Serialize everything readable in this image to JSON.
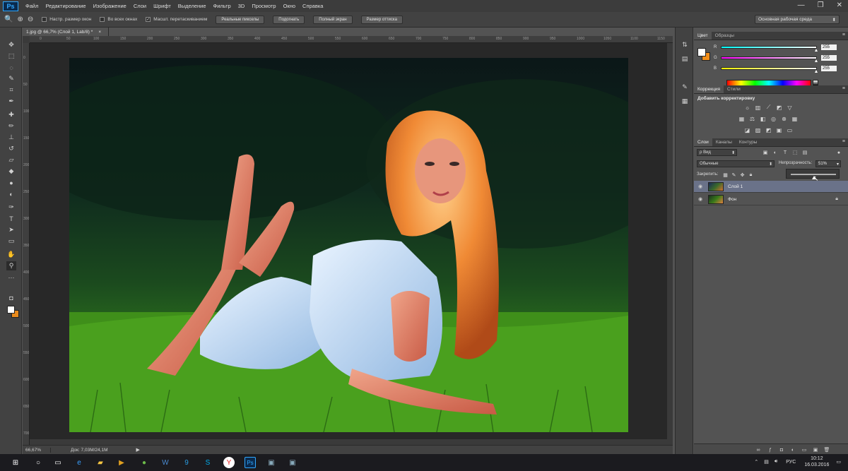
{
  "app": {
    "logo": "Ps"
  },
  "menu": [
    "Файл",
    "Редактирование",
    "Изображение",
    "Слои",
    "Шрифт",
    "Выделение",
    "Фильтр",
    "3D",
    "Просмотр",
    "Окно",
    "Справка"
  ],
  "window_controls": {
    "minimize": "—",
    "restore": "❐",
    "close": "✕"
  },
  "options": {
    "zoom_icon": "🔍",
    "resize_windows": "Настр. размер окон",
    "all_windows": "Во всех окнах",
    "scrubby_zoom": "Масшт. перетаскиванием",
    "actual_pixels": "Реальные пикселы",
    "fit_screen": "Подогнать",
    "full_screen": "Полный экран",
    "print_size": "Размер оттиска",
    "workspace": "Основная рабочая среда"
  },
  "document": {
    "tab_title": "1.jpg @ 66,7% (Слой 1, Lab/8) *",
    "tab_close": "×",
    "status_zoom": "66,67%",
    "status_info": "Док: 7,03M/24,1M",
    "status_arrow": "▶"
  },
  "ruler": [
    "0",
    "50",
    "100",
    "150",
    "200",
    "250",
    "300",
    "350",
    "400",
    "450",
    "500",
    "550",
    "600",
    "650",
    "700",
    "750",
    "800",
    "850",
    "900",
    "950",
    "1000",
    "1050",
    "1100",
    "1150"
  ],
  "color_panel": {
    "tabs": [
      "Цвет",
      "Образцы"
    ],
    "rows": [
      {
        "label": "R",
        "value": "255",
        "gradient": "linear-gradient(to right,#00ffff,#ffffff)"
      },
      {
        "label": "G",
        "value": "255",
        "gradient": "linear-gradient(to right,#ff00ff,#ffffff)"
      },
      {
        "label": "B",
        "value": "255",
        "gradient": "linear-gradient(to right,#ffff00,#ffffff)"
      }
    ],
    "fg": "#ffffff",
    "bg": "#f18e1a"
  },
  "adjustments": {
    "tabs": [
      "Коррекция",
      "Стили"
    ],
    "title": "Добавить корректировку"
  },
  "layers": {
    "tabs": [
      "Слои",
      "Каналы",
      "Контуры"
    ],
    "kind": "ρ Вид",
    "blend": "Обычные",
    "opacity_label": "Непрозрачность:",
    "opacity_value": "51%",
    "opacity_fraction": 0.51,
    "lock_label": "Закрепить:",
    "items": [
      {
        "name": "Слой 1",
        "active": true,
        "locked": false
      },
      {
        "name": "Фон",
        "active": false,
        "locked": true
      }
    ]
  },
  "taskbar": {
    "lang": "РУС",
    "time": "10:12",
    "date": "16.03.2016"
  }
}
